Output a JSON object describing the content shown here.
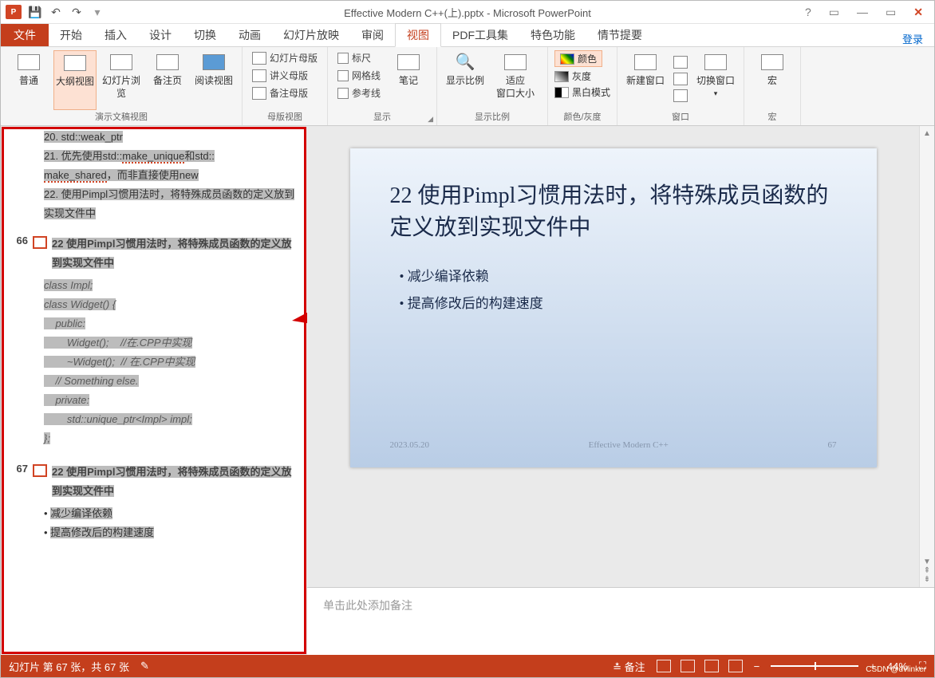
{
  "title": "Effective Modern C++(上).pptx - Microsoft PowerPoint",
  "qat": {
    "logo": "P",
    "save": "💾",
    "undo": "↶",
    "redo": "↷",
    "start": "▶"
  },
  "winbtns": {
    "help": "?",
    "optbox": "▭",
    "min": "—",
    "max": "▭",
    "close": "✕"
  },
  "login": "登录",
  "tabs": {
    "file": "文件",
    "home": "开始",
    "insert": "插入",
    "design": "设计",
    "trans": "切换",
    "anim": "动画",
    "slideshow": "幻灯片放映",
    "review": "审阅",
    "view": "视图",
    "pdf": "PDF工具集",
    "special": "特色功能",
    "story": "情节提要"
  },
  "ribbon": {
    "g1": {
      "normal": "普通",
      "outline": "大纲视图",
      "browser": "幻灯片浏览",
      "notepg": "备注页",
      "read": "阅读视图",
      "label": "演示文稿视图"
    },
    "g2": {
      "slmaster": "幻灯片母版",
      "hdmaster": "讲义母版",
      "ntmaster": "备注母版",
      "label": "母版视图"
    },
    "g3": {
      "ruler": "标尺",
      "grid": "网格线",
      "guide": "参考线",
      "notes": "笔记",
      "label": "显示"
    },
    "g4": {
      "zoom": "显示比例",
      "fit": "适应\n窗口大小",
      "label": "显示比例"
    },
    "g5": {
      "color": "颜色",
      "gray": "灰度",
      "bw": "黑白模式",
      "label": "颜色/灰度"
    },
    "g6": {
      "newwin": "新建窗口",
      "switch": "切换窗口",
      "label": "窗口"
    },
    "g7": {
      "macro": "宏",
      "label": "宏"
    }
  },
  "outline": {
    "pre20": "20. std::weak_ptr",
    "item21a": "21. 优先使用std::",
    "item21a_u": "make_unique",
    "item21b": "和std::",
    "item21b_u": "make_shared",
    "item21c": "，而非直接使用new",
    "item22": "22. 使用Pimpl习惯用法时，将特殊成员函数的定义放到实现文件中",
    "num66": "66",
    "title66": "22 使用Pimpl习惯用法时，将特殊成员函数的定义放到实现文件中",
    "c1": "class Impl;",
    "c2": "class Widget() {",
    "c3": "    public:",
    "c4": "        Widget();    //在.CPP中实现",
    "c5": "        ~Widget();  // 在.CPP中实现",
    "c6": "    // Something else.",
    "c7": "    private:",
    "c8": "        std::unique_ptr<Impl> impl;",
    "c9": "};",
    "num67": "67",
    "title67": "22 使用Pimpl习惯用法时，将特殊成员函数的定义放到实现文件中",
    "b1": "减少编译依赖",
    "b2": "提高修改后的构建速度"
  },
  "slide": {
    "title": "22 使用Pimpl习惯用法时，将特殊成员函数的定义放到实现文件中",
    "p1": "减少编译依赖",
    "p2": "提高修改后的构建速度",
    "date": "2023.05.20",
    "mid": "Effective Modern C++",
    "page": "67"
  },
  "notes_placeholder": "单击此处添加备注",
  "status": {
    "slide": "幻灯片 第 67 张，共 67 张",
    "lang": "",
    "notes": "备注",
    "zoom": "44%"
  },
  "watermark": "CSDN @dvlinker"
}
